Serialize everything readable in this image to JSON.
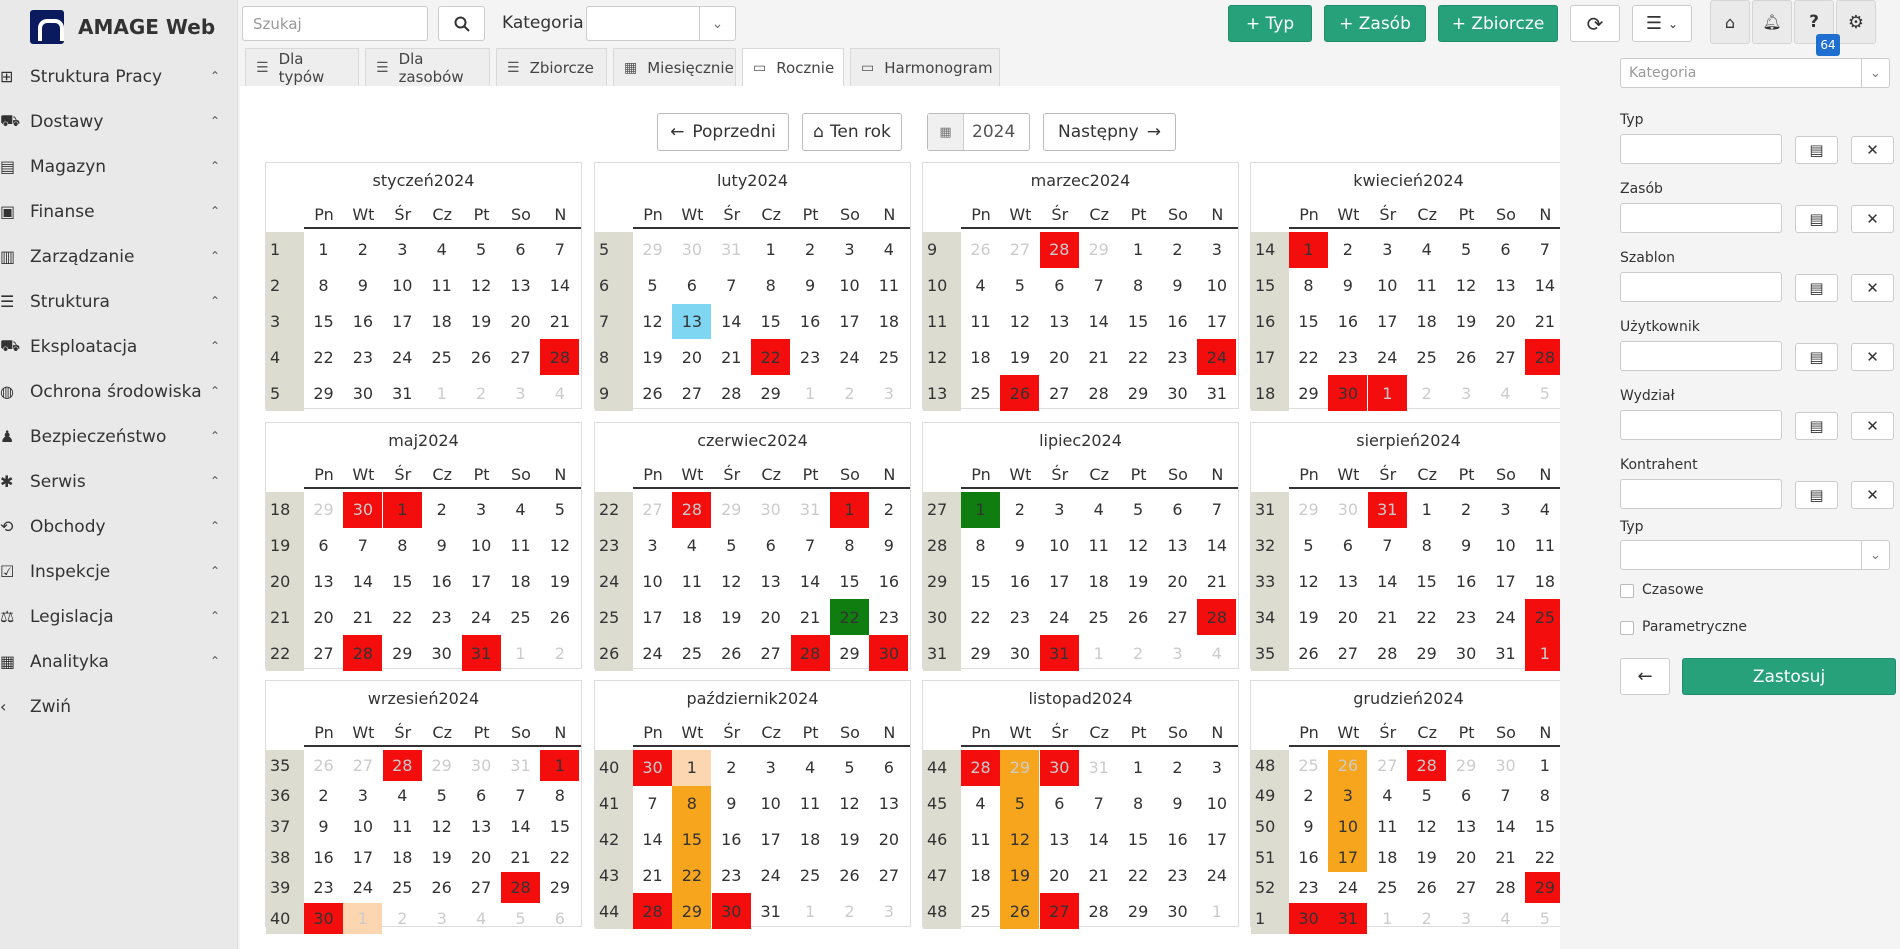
{
  "app": {
    "title": "AMAGE Web"
  },
  "sidebar": {
    "items": [
      {
        "label": "Struktura Pracy",
        "icon": "sitemap-icon",
        "g": "⊞"
      },
      {
        "label": "Dostawy",
        "icon": "truck-icon",
        "g": "⛟"
      },
      {
        "label": "Magazyn",
        "icon": "warehouse-icon",
        "g": "▤"
      },
      {
        "label": "Finanse",
        "icon": "money-icon",
        "g": "▣"
      },
      {
        "label": "Zarządzanie",
        "icon": "building-icon",
        "g": "▥"
      },
      {
        "label": "Struktura",
        "icon": "list-icon",
        "g": "☰"
      },
      {
        "label": "Eksploatacja",
        "icon": "forklift-icon",
        "g": "⛟"
      },
      {
        "label": "Ochrona środowiska",
        "icon": "globe-icon",
        "g": "◍"
      },
      {
        "label": "Bezpieczeństwo",
        "icon": "user-shield-icon",
        "g": "♟"
      },
      {
        "label": "Serwis",
        "icon": "bug-icon",
        "g": "✱"
      },
      {
        "label": "Obchody",
        "icon": "route-icon",
        "g": "⟲"
      },
      {
        "label": "Inspekcje",
        "icon": "check-square-icon",
        "g": "☑"
      },
      {
        "label": "Legislacja",
        "icon": "gavel-icon",
        "g": "⚖"
      },
      {
        "label": "Analityka",
        "icon": "chart-icon",
        "g": "▦"
      },
      {
        "label": "Zwiń",
        "icon": "chevron-left-icon",
        "g": "‹"
      }
    ]
  },
  "topbar": {
    "search_placeholder": "Szukaj",
    "kategoria_label": "Kategoria",
    "btn_typ": "+ Typ",
    "btn_zasob": "+ Zasób",
    "btn_zbiorcze": "+ Zbiorcze",
    "badge": "64"
  },
  "tabs": [
    "Dla typów",
    "Dla zasobów",
    "Zbiorcze",
    "Miesięcznie",
    "Rocznie",
    "Harmonogram"
  ],
  "controls": {
    "prev": "Poprzedni",
    "this_year": "Ten rok",
    "year": "2024",
    "next": "Następny"
  },
  "day_names": [
    "Pn",
    "Wt",
    "Śr",
    "Cz",
    "Pt",
    "So",
    "N"
  ],
  "months": [
    {
      "title": "styczeń2024",
      "weeks": [
        "1",
        "2",
        "3",
        "4",
        "5"
      ],
      "days": [
        "1",
        "2",
        "3",
        "4",
        "5",
        "6",
        "7",
        "8",
        "9",
        "10",
        "11",
        "12",
        "13",
        "14",
        "15",
        "16",
        "17",
        "18",
        "19",
        "20",
        "21",
        "22",
        "23",
        "24",
        "25",
        "26",
        "27",
        "28",
        "29",
        "30",
        "31",
        "1",
        "2",
        "3",
        "4"
      ]
    },
    {
      "title": "luty2024",
      "weeks": [
        "5",
        "6",
        "7",
        "8",
        "9"
      ],
      "days": [
        "29",
        "30",
        "31",
        "1",
        "2",
        "3",
        "4",
        "5",
        "6",
        "7",
        "8",
        "9",
        "10",
        "11",
        "12",
        "13",
        "14",
        "15",
        "16",
        "17",
        "18",
        "19",
        "20",
        "21",
        "22",
        "23",
        "24",
        "25",
        "26",
        "27",
        "28",
        "29",
        "1",
        "2",
        "3"
      ]
    },
    {
      "title": "marzec2024",
      "weeks": [
        "9",
        "10",
        "11",
        "12",
        "13"
      ],
      "days": [
        "26",
        "27",
        "28",
        "29",
        "1",
        "2",
        "3",
        "4",
        "5",
        "6",
        "7",
        "8",
        "9",
        "10",
        "11",
        "12",
        "13",
        "14",
        "15",
        "16",
        "17",
        "18",
        "19",
        "20",
        "21",
        "22",
        "23",
        "24",
        "25",
        "26",
        "27",
        "28",
        "29",
        "30",
        "31"
      ]
    },
    {
      "title": "kwiecień2024",
      "weeks": [
        "14",
        "15",
        "16",
        "17",
        "18"
      ],
      "days": [
        "1",
        "2",
        "3",
        "4",
        "5",
        "6",
        "7",
        "8",
        "9",
        "10",
        "11",
        "12",
        "13",
        "14",
        "15",
        "16",
        "17",
        "18",
        "19",
        "20",
        "21",
        "22",
        "23",
        "24",
        "25",
        "26",
        "27",
        "28",
        "29",
        "30",
        "1",
        "2",
        "3",
        "4",
        "5"
      ]
    },
    {
      "title": "maj2024",
      "weeks": [
        "18",
        "19",
        "20",
        "21",
        "22"
      ],
      "days": [
        "29",
        "30",
        "1",
        "2",
        "3",
        "4",
        "5",
        "6",
        "7",
        "8",
        "9",
        "10",
        "11",
        "12",
        "13",
        "14",
        "15",
        "16",
        "17",
        "18",
        "19",
        "20",
        "21",
        "22",
        "23",
        "24",
        "25",
        "26",
        "27",
        "28",
        "29",
        "30",
        "31",
        "1",
        "2"
      ]
    },
    {
      "title": "czerwiec2024",
      "weeks": [
        "22",
        "23",
        "24",
        "25",
        "26"
      ],
      "days": [
        "27",
        "28",
        "29",
        "30",
        "31",
        "1",
        "2",
        "3",
        "4",
        "5",
        "6",
        "7",
        "8",
        "9",
        "10",
        "11",
        "12",
        "13",
        "14",
        "15",
        "16",
        "17",
        "18",
        "19",
        "20",
        "21",
        "22",
        "23",
        "24",
        "25",
        "26",
        "27",
        "28",
        "29",
        "30"
      ]
    },
    {
      "title": "lipiec2024",
      "weeks": [
        "27",
        "28",
        "29",
        "30",
        "31"
      ],
      "days": [
        "1",
        "2",
        "3",
        "4",
        "5",
        "6",
        "7",
        "8",
        "9",
        "10",
        "11",
        "12",
        "13",
        "14",
        "15",
        "16",
        "17",
        "18",
        "19",
        "20",
        "21",
        "22",
        "23",
        "24",
        "25",
        "26",
        "27",
        "28",
        "29",
        "30",
        "31",
        "1",
        "2",
        "3",
        "4"
      ]
    },
    {
      "title": "sierpień2024",
      "weeks": [
        "31",
        "32",
        "33",
        "34",
        "35"
      ],
      "days": [
        "29",
        "30",
        "31",
        "1",
        "2",
        "3",
        "4",
        "5",
        "6",
        "7",
        "8",
        "9",
        "10",
        "11",
        "12",
        "13",
        "14",
        "15",
        "16",
        "17",
        "18",
        "19",
        "20",
        "21",
        "22",
        "23",
        "24",
        "25",
        "26",
        "27",
        "28",
        "29",
        "30",
        "31",
        "1"
      ]
    },
    {
      "title": "wrzesień2024",
      "weeks": [
        "35",
        "36",
        "37",
        "38",
        "39",
        "40"
      ],
      "days": [
        "26",
        "27",
        "28",
        "29",
        "30",
        "31",
        "1",
        "2",
        "3",
        "4",
        "5",
        "6",
        "7",
        "8",
        "9",
        "10",
        "11",
        "12",
        "13",
        "14",
        "15",
        "16",
        "17",
        "18",
        "19",
        "20",
        "21",
        "22",
        "23",
        "24",
        "25",
        "26",
        "27",
        "28",
        "29",
        "30",
        "1",
        "2",
        "3",
        "4",
        "5",
        "6"
      ]
    },
    {
      "title": "październik2024",
      "weeks": [
        "40",
        "41",
        "42",
        "43",
        "44"
      ],
      "days": [
        "30",
        "1",
        "2",
        "3",
        "4",
        "5",
        "6",
        "7",
        "8",
        "9",
        "10",
        "11",
        "12",
        "13",
        "14",
        "15",
        "16",
        "17",
        "18",
        "19",
        "20",
        "21",
        "22",
        "23",
        "24",
        "25",
        "26",
        "27",
        "28",
        "29",
        "30",
        "31",
        "1",
        "2",
        "3"
      ]
    },
    {
      "title": "listopad2024",
      "weeks": [
        "44",
        "45",
        "46",
        "47",
        "48"
      ],
      "days": [
        "28",
        "29",
        "30",
        "31",
        "1",
        "2",
        "3",
        "4",
        "5",
        "6",
        "7",
        "8",
        "9",
        "10",
        "11",
        "12",
        "13",
        "14",
        "15",
        "16",
        "17",
        "18",
        "19",
        "20",
        "21",
        "22",
        "23",
        "24",
        "25",
        "26",
        "27",
        "28",
        "29",
        "30",
        "1"
      ]
    },
    {
      "title": "grudzień2024",
      "weeks": [
        "48",
        "49",
        "50",
        "51",
        "52",
        "1"
      ],
      "days": [
        "25",
        "26",
        "27",
        "28",
        "29",
        "30",
        "1",
        "2",
        "3",
        "4",
        "5",
        "6",
        "7",
        "8",
        "9",
        "10",
        "11",
        "12",
        "13",
        "14",
        "15",
        "16",
        "17",
        "18",
        "19",
        "20",
        "21",
        "22",
        "23",
        "24",
        "25",
        "26",
        "27",
        "28",
        "29",
        "30",
        "31",
        "1",
        "2",
        "3",
        "4",
        "5"
      ]
    }
  ],
  "day_status": {
    "colors": {
      "r": "#f40d0d",
      "b": "#7fd6f2",
      "gr": "#0f7d0f",
      "or": "#f7a51c",
      "pe": "#fbd6b0"
    },
    "marks": [
      {
        "r": [
          27
        ]
      },
      {
        "b": [
          15
        ],
        "r": [
          24
        ]
      },
      {
        "r": [
          2,
          27,
          29
        ]
      },
      {
        "r": [
          0,
          27,
          29,
          30
        ]
      },
      {
        "r": [
          1,
          2,
          29,
          32
        ]
      },
      {
        "r": [
          1,
          5,
          32,
          34
        ],
        "gr": [
          26
        ]
      },
      {
        "gr": [
          0
        ],
        "r": [
          27,
          30
        ]
      },
      {
        "r": [
          2,
          27,
          34
        ]
      },
      {
        "r": [
          2,
          6,
          33,
          35
        ],
        "pe": [
          36
        ]
      },
      {
        "r": [
          0,
          28,
          30
        ],
        "pe": [
          1
        ],
        "or": [
          8,
          15,
          22,
          29
        ]
      },
      {
        "r": [
          0,
          2,
          30
        ],
        "or": [
          1,
          8,
          15,
          22,
          29
        ]
      },
      {
        "r": [
          3,
          34,
          35,
          36
        ],
        "or": [
          1,
          8,
          15,
          22
        ]
      }
    ]
  },
  "filters": {
    "kategoria_placeholder": "Kategoria",
    "fields": [
      "Typ",
      "Zasób",
      "Szablon",
      "Użytkownik",
      "Wydział",
      "Kontrahent"
    ],
    "typ2_label": "Typ",
    "czasowe": "Czasowe",
    "parametryczne": "Parametryczne",
    "apply": "Zastosuj"
  }
}
